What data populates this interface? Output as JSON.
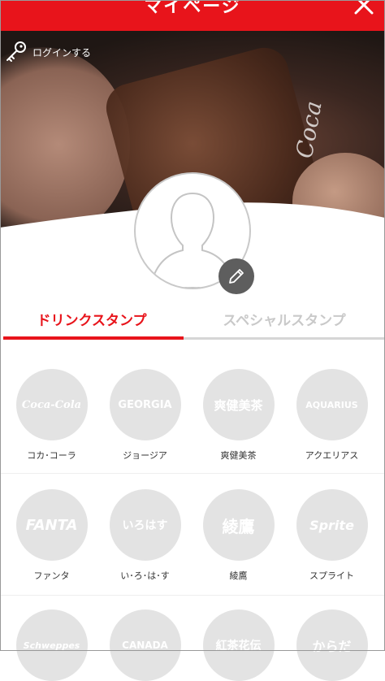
{
  "header": {
    "title": "マイページ",
    "close_icon": "close-icon"
  },
  "hero": {
    "login_label": "ログインする",
    "login_icon": "key-icon",
    "brand_text": "Coca"
  },
  "profile": {
    "avatar_icon": "user-silhouette-icon",
    "edit_icon": "pencil-icon"
  },
  "tabs": [
    {
      "label": "ドリンクスタンプ",
      "active": true
    },
    {
      "label": "スペシャルスタンプ",
      "active": false
    }
  ],
  "stamps": [
    {
      "logo": "Coca-Cola",
      "label": "コカ･コーラ"
    },
    {
      "logo": "GEORGIA",
      "label": "ジョージア"
    },
    {
      "logo": "爽健美茶",
      "label": "爽健美茶"
    },
    {
      "logo": "AQUARIUS",
      "label": "アクエリアス"
    },
    {
      "logo": "FANTA",
      "label": "ファンタ"
    },
    {
      "logo": "いろはす",
      "label": "い･ろ･は･す"
    },
    {
      "logo": "綾鷹",
      "label": "綾鷹"
    },
    {
      "logo": "Sprite",
      "label": "スプライト"
    },
    {
      "logo": "Schweppes",
      "label": ""
    },
    {
      "logo": "CANADA",
      "label": ""
    },
    {
      "logo": "紅茶花伝",
      "label": ""
    },
    {
      "logo": "からだ",
      "label": ""
    }
  ],
  "colors": {
    "accent": "#e8141b",
    "stamp_gray": "#e3e3e3"
  }
}
